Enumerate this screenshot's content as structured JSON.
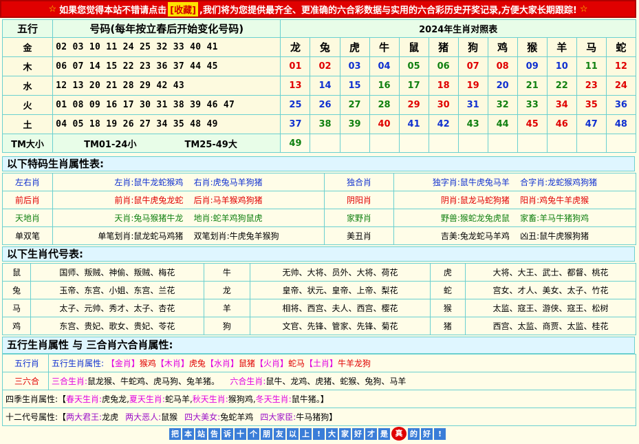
{
  "banner": {
    "star": "☆",
    "before": "如果您觉得本站不错请点击",
    "fav": "[收藏]",
    "after": ",我们将为您提供最齐全、更准确的六合彩数据与实用的六合彩历史开奖记录,方便大家长期跟踪!",
    "star2": "☆"
  },
  "header": {
    "wuxing": "五行",
    "numbers": "号码(每年按立春后开始变化号码)",
    "title": "2024年生肖对照表"
  },
  "zodiacs": [
    "龙",
    "兔",
    "虎",
    "牛",
    "鼠",
    "猪",
    "狗",
    "鸡",
    "猴",
    "羊",
    "马",
    "蛇"
  ],
  "rows": [
    {
      "el": "金",
      "nums": "02 03 10 11 24 25 32 33 40 41",
      "cells": [
        "01",
        "02",
        "03",
        "04",
        "05",
        "06",
        "07",
        "08",
        "09",
        "10",
        "11",
        "12"
      ]
    },
    {
      "el": "木",
      "nums": "06 07 14 15 22 23 36 37 44 45",
      "cells": [
        "13",
        "14",
        "15",
        "16",
        "17",
        "18",
        "19",
        "20",
        "21",
        "22",
        "23",
        "24"
      ]
    },
    {
      "el": "水",
      "nums": "12 13 20 21 28 29 42 43",
      "cells": [
        "25",
        "26",
        "27",
        "28",
        "29",
        "30",
        "31",
        "32",
        "33",
        "34",
        "35",
        "36"
      ]
    },
    {
      "el": "火",
      "nums": "01 08 09 16 17 30 31 38 39 46 47",
      "cells": [
        "37",
        "38",
        "39",
        "40",
        "41",
        "42",
        "43",
        "44",
        "45",
        "46",
        "47",
        "48"
      ]
    },
    {
      "el": "土",
      "nums": "04 05 18 19 26 27 34 35 48 49",
      "cells": [
        "49"
      ]
    }
  ],
  "tm": {
    "label": "TM大小",
    "small": "TM01-24小",
    "big": "TM25-49大"
  },
  "section1": "以下特码生肖属性表:",
  "attrs": [
    {
      "k": "左右肖",
      "a": "左肖:鼠牛龙蛇猴鸡",
      "b": "右肖:虎兔马羊狗猪",
      "k2": "独合肖",
      "c": "独字肖:鼠牛虎兔马羊",
      "d": "合字肖:龙蛇猴鸡狗猪"
    },
    {
      "k": "前后肖",
      "a": "前肖:鼠牛虎兔龙蛇",
      "b": "后肖:马羊猴鸡狗猪",
      "k2": "阴阳肖",
      "c": "阴肖:鼠龙马蛇狗猪",
      "d": "阳肖:鸡兔牛羊虎猴"
    },
    {
      "k": "天地肖",
      "a": "天肖:兔马猴猪牛龙",
      "b": "地肖:蛇羊鸡狗鼠虎",
      "k2": "家野肖",
      "c": "野兽:猴蛇龙兔虎鼠",
      "d": "家畜:羊马牛猪狗鸡"
    },
    {
      "k": "单双笔",
      "a": "单笔划肖:鼠龙蛇马鸡猪",
      "b": "双笔划肖:牛虎兔羊猴狗",
      "k2": "美丑肖",
      "c": "吉美:兔龙蛇马羊鸡",
      "d": "凶丑:鼠牛虎猴狗猪"
    }
  ],
  "section2": "以下生肖代号表:",
  "codes": [
    [
      "鼠",
      "国师、叛贼、神偷、叛贼、梅花",
      "牛",
      "无帅、大将、员外、大将、荷花",
      "虎",
      "大将、大王、武士、都督、桃花"
    ],
    [
      "兔",
      "玉帝、东宫、小姐、东宫、兰花",
      "龙",
      "皇帝、状元、皇帝、上帝、梨花",
      "蛇",
      "宫女、才人、美女、太子、竹花"
    ],
    [
      "马",
      "太子、元帅、秀才、太子、杏花",
      "羊",
      "相将、西宫、夫人、西宫、樱花",
      "猴",
      "太监、寇王、游侠、寇王、松树"
    ],
    [
      "鸡",
      "东宫、贵妃、歌女、贵妃、苓花",
      "狗",
      "文官、先锋、管家、先锋、菊花",
      "猪",
      "西宫、太监、商贾、太监、桂花"
    ]
  ],
  "section3": "五行生肖属性 与 三合肖六合肖属性:",
  "wx": {
    "label": "五行肖",
    "prefix": "五行生肖属性:",
    "items": [
      "【金肖】",
      "猴鸡",
      "【木肖】",
      "虎兔",
      "【水肖】",
      "鼠猪",
      "【火肖】",
      "蛇马",
      "【土肖】",
      "牛羊龙狗"
    ]
  },
  "sanliu": {
    "label": "三六合",
    "s_label": "三合生肖:",
    "s_val": "鼠龙猴、牛蛇鸡、虎马狗、兔羊猪。",
    "l_label": "六合生肖:",
    "l_val": "鼠牛、龙鸡、虎猪、蛇猴、兔狗、马羊"
  },
  "season": {
    "prefix": "四季生肖属性:【",
    "items": [
      "春天生肖:",
      "虎兔龙,",
      "夏天生肖:",
      "蛇马羊,",
      "秋天生肖:",
      "猴狗鸡,",
      "冬天生肖:",
      "鼠牛猪。"
    ],
    "end": "】"
  },
  "twelve": {
    "prefix": "十二代号属性:【",
    "items": [
      "两大君王:",
      "龙虎",
      "两大恶人:",
      "鼠猴",
      "四大美女:",
      "兔蛇羊鸡",
      "四大家臣:",
      "牛马猪狗"
    ],
    "end": "】"
  },
  "footer": [
    "把",
    "本",
    "站",
    "告",
    "诉",
    "十",
    "个",
    "朋",
    "友",
    "以",
    "上",
    "!",
    "大",
    "家",
    "好",
    "才",
    "是",
    "真",
    "的",
    "好",
    "!"
  ]
}
